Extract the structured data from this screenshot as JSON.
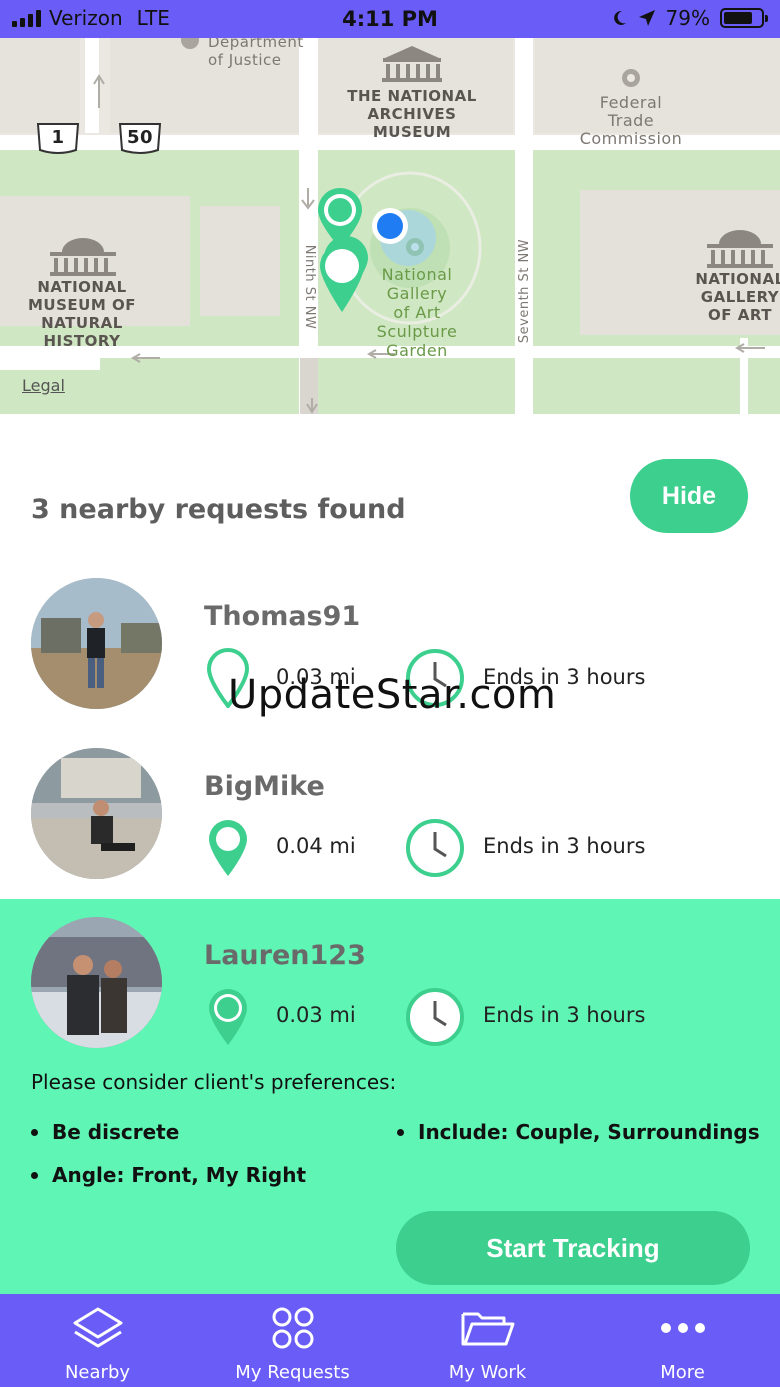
{
  "status_bar": {
    "carrier": "Verizon",
    "network": "LTE",
    "time": "4:11 PM",
    "battery": "79%"
  },
  "map": {
    "labels": {
      "justice": "Department\nof Justice",
      "archives": "THE NATIONAL\nARCHIVES\nMUSEUM",
      "ftc": "Federal\nTrade\nCommission",
      "natural_history": "NATIONAL\nMUSEUM OF\nNATURAL\nHISTORY",
      "sculpture_garden": "National\nGallery\nof Art\nSculpture\nGarden",
      "gallery_of_art": "NATIONAL\nGALLERY\nOF ART",
      "ninth_st": "Ninth St NW",
      "seventh_st": "Seventh St NW",
      "route_1": "1",
      "route_50": "50"
    },
    "legal": "Legal"
  },
  "panel": {
    "count_text": "3 nearby requests found",
    "hide_label": "Hide"
  },
  "requests": [
    {
      "username": "Thomas91",
      "distance": "0.03 mi",
      "ends": "Ends in 3 hours"
    },
    {
      "username": "BigMike",
      "distance": "0.04 mi",
      "ends": "Ends in 3 hours"
    },
    {
      "username": "Lauren123",
      "distance": "0.03 mi",
      "ends": "Ends in 3 hours"
    }
  ],
  "selected": {
    "prefs_title": "Please consider client's preferences:",
    "prefs": [
      "Be discrete",
      "Include: Couple, Surroundings",
      "Angle: Front, My Right"
    ],
    "start_label": "Start Tracking"
  },
  "watermark": "UpdateStar.com",
  "tabs": [
    {
      "label": "Nearby",
      "icon": "layers-icon"
    },
    {
      "label": "My Requests",
      "icon": "grid-icon"
    },
    {
      "label": "My Work",
      "icon": "folder-icon"
    },
    {
      "label": "More",
      "icon": "more-icon"
    }
  ],
  "colors": {
    "accent_purple": "#6a5cf6",
    "accent_green": "#3ccf8e",
    "selected_bg": "#5ff5b4"
  }
}
